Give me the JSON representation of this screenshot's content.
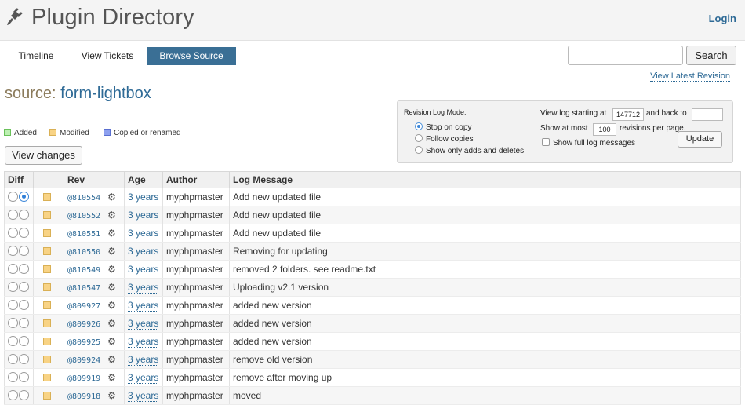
{
  "header": {
    "title": "Plugin Directory",
    "login": "Login",
    "logo_icon": "plug-icon"
  },
  "nav": {
    "tabs": [
      {
        "label": "Timeline",
        "active": false
      },
      {
        "label": "View Tickets",
        "active": false
      },
      {
        "label": "Browse Source",
        "active": true
      }
    ],
    "search_value": "",
    "search_button": "Search",
    "view_latest": "View Latest Revision"
  },
  "source": {
    "prefix": "source:",
    "name": "form-lightbox"
  },
  "legend": {
    "items": [
      {
        "label": "Added",
        "color": "#bdf0b2",
        "border": "#6ac15a"
      },
      {
        "label": "Modified",
        "color": "#f8d385",
        "border": "#d9b055"
      },
      {
        "label": "Copied or renamed",
        "color": "#8da0ef",
        "border": "#5a6fd0"
      }
    ]
  },
  "view_changes": "View changes",
  "revlog": {
    "mode_title": "Revision Log Mode:",
    "modes": [
      {
        "label": "Stop on copy",
        "selected": true
      },
      {
        "label": "Follow copies",
        "selected": false
      },
      {
        "label": "Show only adds and deletes",
        "selected": false
      }
    ],
    "starting_at_label": "View log starting at",
    "starting_at_value": "147712",
    "back_to_label": "and back to",
    "back_to_value": "",
    "show_at_most_label": "Show at most",
    "show_at_most_value": "100",
    "revisions_per_page": "revisions per page.",
    "full_log_label": "Show full log messages",
    "update_button": "Update"
  },
  "table": {
    "headers": {
      "diff": "Diff",
      "chg": "",
      "rev": "Rev",
      "age": "Age",
      "author": "Author",
      "msg": "Log Message"
    },
    "rows": [
      {
        "rev": "@810554",
        "age": "3 years",
        "author": "myphpmaster",
        "message": "Add new updated file",
        "new_selected": true
      },
      {
        "rev": "@810552",
        "age": "3 years",
        "author": "myphpmaster",
        "message": "Add new updated file",
        "new_selected": false
      },
      {
        "rev": "@810551",
        "age": "3 years",
        "author": "myphpmaster",
        "message": "Add new updated file",
        "new_selected": false
      },
      {
        "rev": "@810550",
        "age": "3 years",
        "author": "myphpmaster",
        "message": "Removing for updating",
        "new_selected": false
      },
      {
        "rev": "@810549",
        "age": "3 years",
        "author": "myphpmaster",
        "message": "removed 2 folders. see readme.txt",
        "new_selected": false
      },
      {
        "rev": "@810547",
        "age": "3 years",
        "author": "myphpmaster",
        "message": "Uploading v2.1 version",
        "new_selected": false
      },
      {
        "rev": "@809927",
        "age": "3 years",
        "author": "myphpmaster",
        "message": "added new version",
        "new_selected": false
      },
      {
        "rev": "@809926",
        "age": "3 years",
        "author": "myphpmaster",
        "message": "added new version",
        "new_selected": false
      },
      {
        "rev": "@809925",
        "age": "3 years",
        "author": "myphpmaster",
        "message": "added new version",
        "new_selected": false
      },
      {
        "rev": "@809924",
        "age": "3 years",
        "author": "myphpmaster",
        "message": "remove old version",
        "new_selected": false
      },
      {
        "rev": "@809919",
        "age": "3 years",
        "author": "myphpmaster",
        "message": "remove after moving up",
        "new_selected": false
      },
      {
        "rev": "@809918",
        "age": "3 years",
        "author": "myphpmaster",
        "message": "moved",
        "new_selected": false
      }
    ]
  }
}
